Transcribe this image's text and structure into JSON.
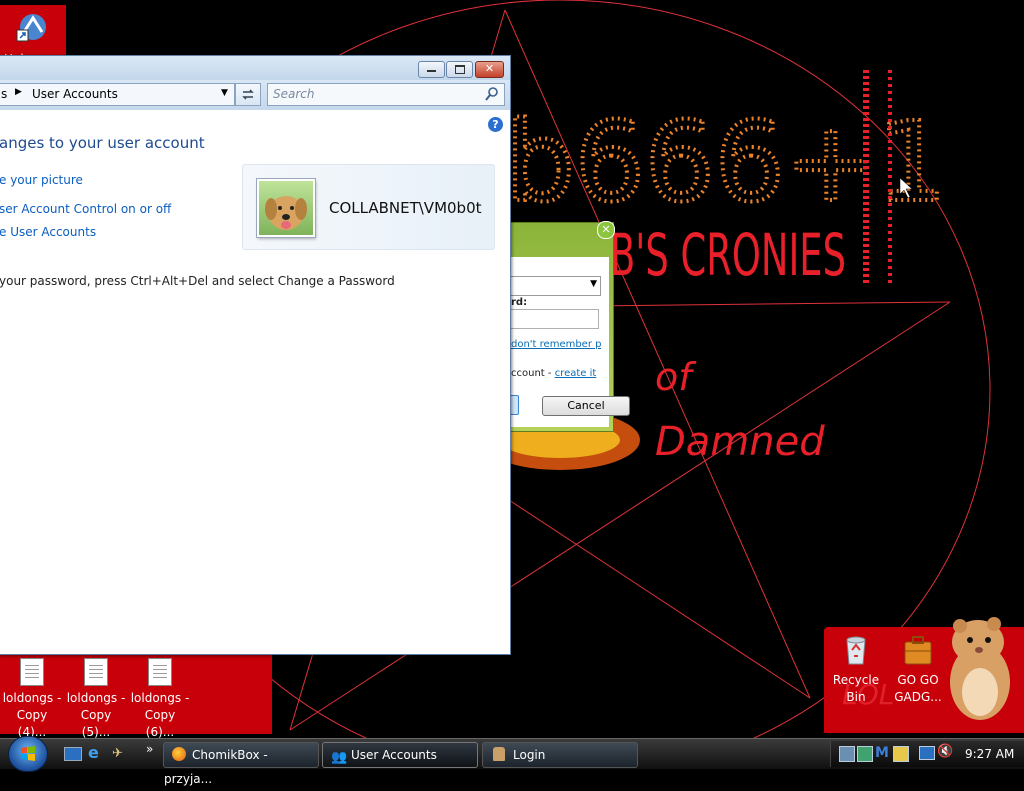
{
  "desktop": {
    "top_left_icon_label": "Hah...",
    "icons_bottom": [
      {
        "label_line1": "loldongs -",
        "label_line2": "Copy (4)..."
      },
      {
        "label_line1": "loldongs -",
        "label_line2": "Copy (5)..."
      },
      {
        "label_line1": "loldongs -",
        "label_line2": "Copy (6)..."
      }
    ],
    "recycle_bin_line1": "Recycle",
    "recycle_bin_line2": "Bin",
    "gadgets_line1": "GO GO",
    "gadgets_line2": "GADG..."
  },
  "wallpaper": {
    "big_text": "b666+1",
    "cronies_text": "B'S CRONIES",
    "of_text": "of",
    "damned_text": "Damned",
    "lol_text": "LOL"
  },
  "login_dialog": {
    "password_label": "rd:",
    "forgot_link": "don't remember pas",
    "account_text": "ccount - ",
    "create_link": "create it",
    "cancel_label": "Cancel"
  },
  "window": {
    "breadcrumb_prefix": "s",
    "breadcrumb": "User Accounts",
    "search_placeholder": "Search",
    "heading": "anges to your user account",
    "links": [
      "e your picture",
      "ser Account Control on or off",
      "e User Accounts"
    ],
    "username": "COLLABNET\\VM0b0t",
    "password_hint": "your password, press Ctrl+Alt+Del and select Change a Password"
  },
  "taskbar": {
    "tasks": [
      {
        "label": "ChomikBox - przyja..."
      },
      {
        "label": "User Accounts"
      },
      {
        "label": "Login"
      }
    ],
    "clock": "9:27 AM"
  },
  "colors": {
    "desktop_red": "#c8000a",
    "wallpaper_red": "#e8202a",
    "window_link": "#0b5ec0",
    "heading_blue": "#1e4b8e"
  }
}
